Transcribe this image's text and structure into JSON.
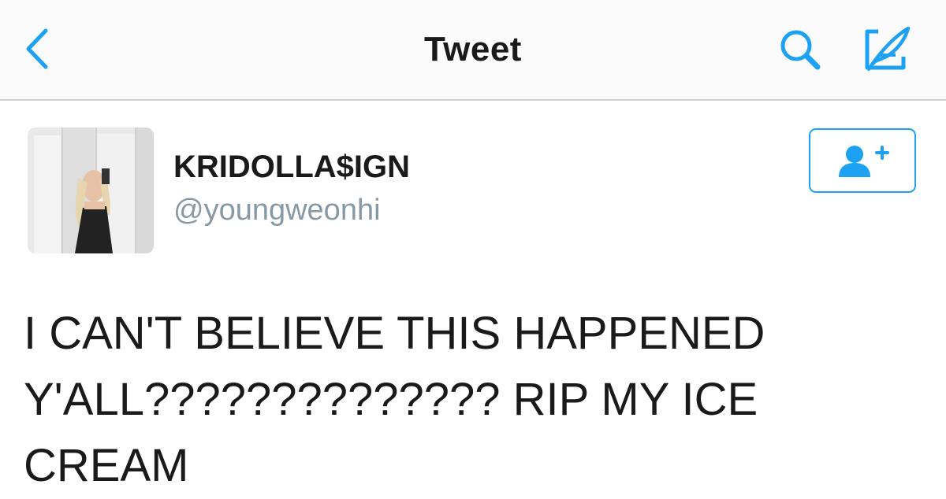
{
  "colors": {
    "accent": "#1da1f2",
    "text": "#1a1a1a",
    "secondary_text": "#8899a6",
    "divider": "#cfd3d6"
  },
  "navbar": {
    "title": "Tweet",
    "back_icon": "chevron-left-icon",
    "search_icon": "search-icon",
    "compose_icon": "compose-icon"
  },
  "tweet": {
    "author": {
      "display_name": "KRIDOLLA$IGN",
      "handle": "@youngweonhi",
      "avatar_icon": "avatar-photo"
    },
    "follow_icon": "follow-user-icon",
    "text": "I CAN'T BELIEVE THIS HAPPENED Y'ALL?????????????? RIP MY ICE CREAM"
  }
}
